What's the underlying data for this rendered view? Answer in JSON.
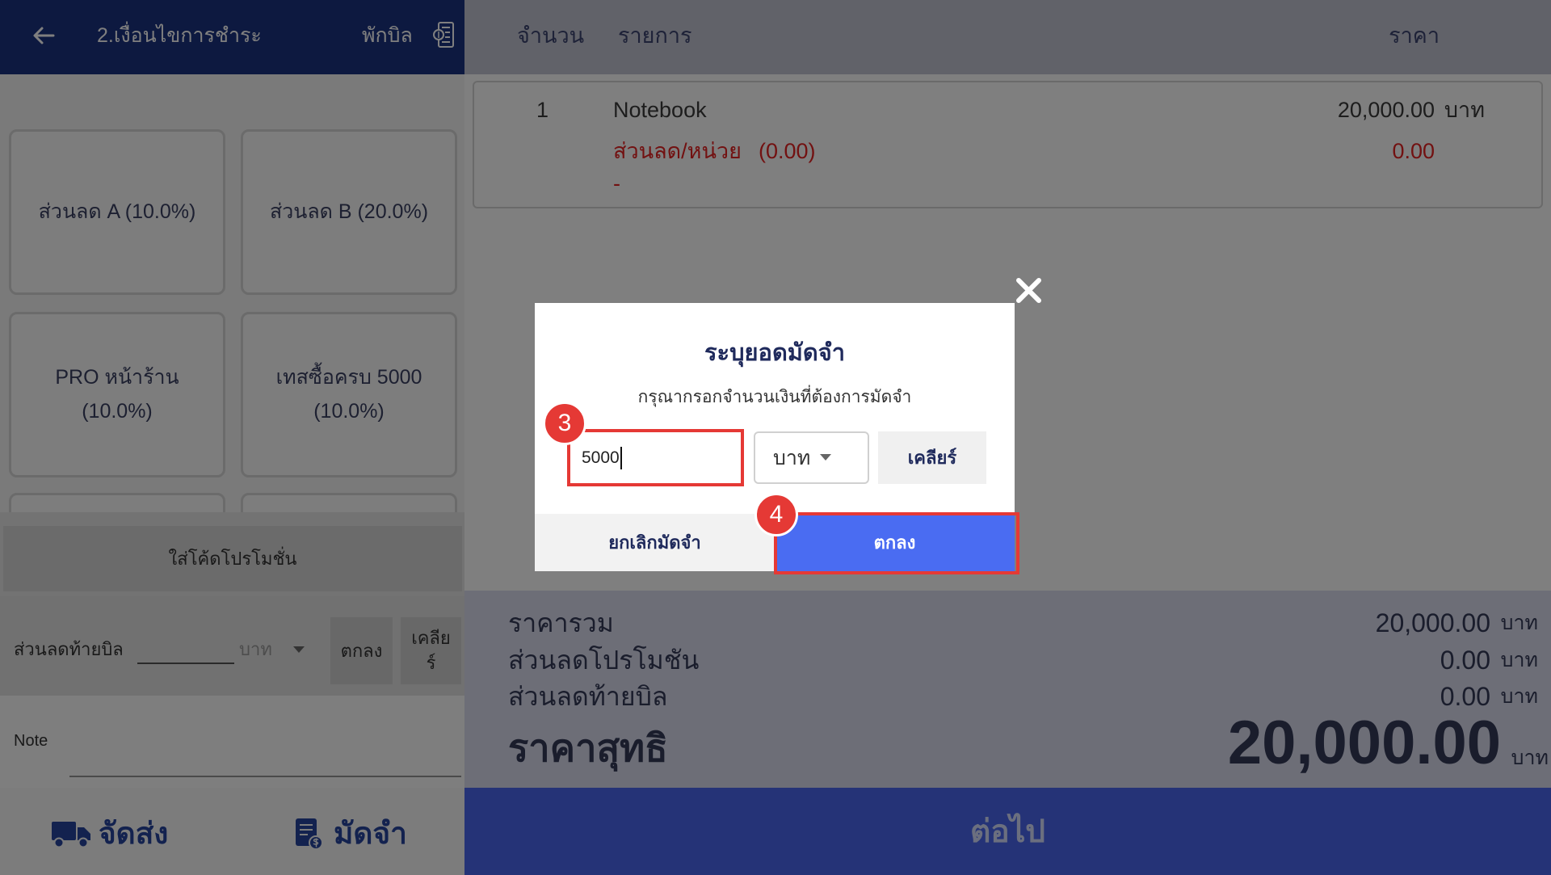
{
  "left_panel": {
    "header": {
      "back_icon": "arrow-left-icon",
      "title": "2.เงื่อนไขการชำระ",
      "hold_bill_label": "พักบิล",
      "hold_bill_icon": "receipt-icon"
    },
    "discount_tiles": [
      {
        "lines": [
          "ส่วนลด A (10.0%)"
        ]
      },
      {
        "lines": [
          "ส่วนลด B (20.0%)"
        ]
      },
      {
        "lines": [
          "PRO หน้าร้าน",
          "(10.0%)"
        ]
      },
      {
        "lines": [
          "เทสซื้อครบ 5000",
          "(10.0%)"
        ]
      }
    ],
    "promo_code_button": "ใส่โค้ดโปรโมชั่น",
    "bill_discount": {
      "label": "ส่วนลดท้ายบิล",
      "value": "",
      "unit": "บาท",
      "confirm_label": "ตกลง",
      "clear_label": "เคลียร์"
    },
    "note": {
      "label": "Note",
      "value": ""
    },
    "actions": {
      "delivery_label": "จัดส่ง",
      "delivery_icon": "truck-icon",
      "deposit_label": "มัดจำ",
      "deposit_icon": "invoice-coin-icon"
    }
  },
  "order_table": {
    "columns": {
      "qty": "จำนวน",
      "item": "รายการ",
      "price": "ราคา"
    },
    "rows": [
      {
        "qty": "1",
        "name": "Notebook",
        "price": "20,000.00",
        "currency": "บาท",
        "unit_discount_label": "ส่วนลด/หน่วย",
        "unit_discount_rate": "(0.00)",
        "unit_discount_amount": "0.00",
        "remark": "-"
      }
    ]
  },
  "summary": {
    "currency": "บาท",
    "subtotal_label": "ราคารวม",
    "subtotal_value": "20,000.00",
    "promo_discount_label": "ส่วนลดโปรโมชัน",
    "promo_discount_value": "0.00",
    "bill_discount_label": "ส่วนลดท้ายบิล",
    "bill_discount_value": "0.00",
    "net_label": "ราคาสุทธิ",
    "net_value": "20,000.00"
  },
  "next_button_label": "ต่อไป",
  "deposit_modal": {
    "title": "ระบุยอดมัดจำ",
    "subtitle": "กรุณากรอกจำนวนเงินที่ต้องการมัดจำ",
    "amount_value": "5000",
    "unit_selected": "บาท",
    "clear_label": "เคลียร์",
    "cancel_label": "ยกเลิกมัดจำ",
    "confirm_label": "ตกลง",
    "close_icon": "close-icon"
  },
  "step_markers": {
    "amount_input": "3",
    "confirm_button": "4"
  },
  "colors": {
    "navy": "#1b3380",
    "accent_blue": "#4a6cf2",
    "highlight_red": "#e53935",
    "discount_red": "#e52222"
  }
}
